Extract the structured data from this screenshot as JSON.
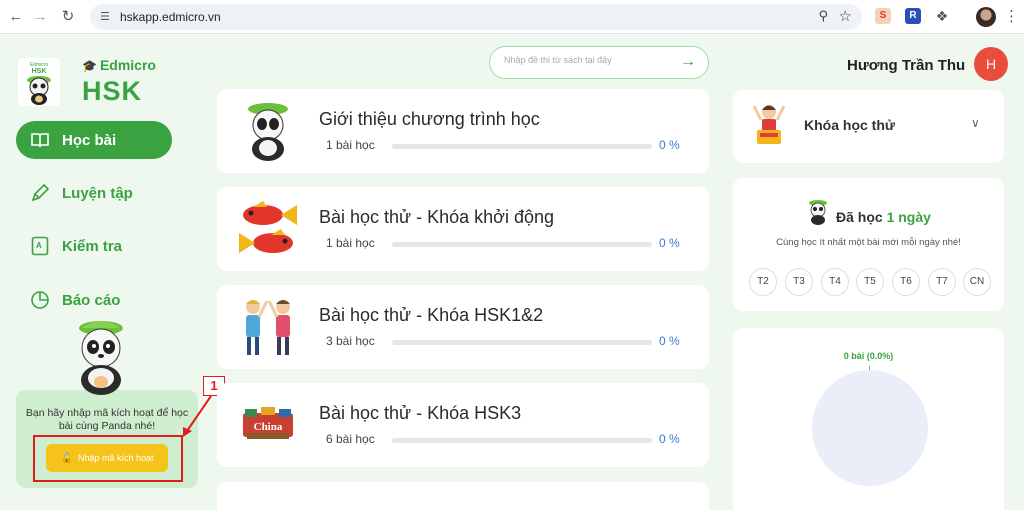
{
  "browser": {
    "url": "hskapp.edmicro.vn",
    "back_icon": "arrow-left",
    "forward_icon": "arrow-right",
    "reload_icon": "reload",
    "site_info_icon": "tune",
    "zoom_icon": "magnifier-minus",
    "star_icon": "star",
    "extensions_icon": "puzzle",
    "menu_icon": "kebab"
  },
  "logo": {
    "brand": "Edmicro",
    "product": "HSK"
  },
  "sidebar": {
    "items": [
      {
        "label": "Học bài",
        "icon": "book-open",
        "active": true
      },
      {
        "label": "Luyện tập",
        "icon": "pencil",
        "active": false
      },
      {
        "label": "Kiểm tra",
        "icon": "exam",
        "active": false
      },
      {
        "label": "Báo cáo",
        "icon": "pie-chart",
        "active": false
      }
    ],
    "activation": {
      "text": "Bạn hãy nhập mã kích hoạt để học bài cùng Panda nhé!",
      "button_label": "Nhập mã kích hoạt",
      "button_icon": "lock",
      "callout_number": "1",
      "highlight_color": "#e11d1d"
    }
  },
  "search": {
    "placeholder": "Nhập đề thi từ sách tại đây",
    "submit_icon": "arrow-right"
  },
  "courses": [
    {
      "title": "Giới thiệu chương trình học",
      "lessons": "1 bài học",
      "progress": 0,
      "percent_label": "0 %",
      "thumb": "panda"
    },
    {
      "title": "Bài học thử - Khóa khởi động",
      "lessons": "1 bài học",
      "progress": 0,
      "percent_label": "0 %",
      "thumb": "red-fish"
    },
    {
      "title": "Bài học thử - Khóa HSK1&2",
      "lessons": "3 bài học",
      "progress": 0,
      "percent_label": "0 %",
      "thumb": "high-five"
    },
    {
      "title": "Bài học thử - Khóa HSK3",
      "lessons": "6 bài học",
      "progress": 0,
      "percent_label": "0 %",
      "thumb": "china-collage"
    }
  ],
  "user": {
    "name": "Hương Trần Thu",
    "initial": "H",
    "avatar_color": "#ea4d3d"
  },
  "trial": {
    "label": "Khóa học thử",
    "chevron_icon": "chevron-down"
  },
  "streak": {
    "prefix": "Đã học",
    "days": "1 ngày",
    "hint": "Cùng học ít nhất một bài mới mỗi ngày nhé!",
    "weekdays": [
      "T2",
      "T3",
      "T4",
      "T5",
      "T6",
      "T7",
      "CN"
    ]
  },
  "stats": {
    "label": "0 bài (0.0%)",
    "value": 0
  },
  "colors": {
    "primary": "#3aa241",
    "accent_yellow": "#f6c31a",
    "percent_blue": "#3a7bd5",
    "background": "#eef8ee"
  }
}
